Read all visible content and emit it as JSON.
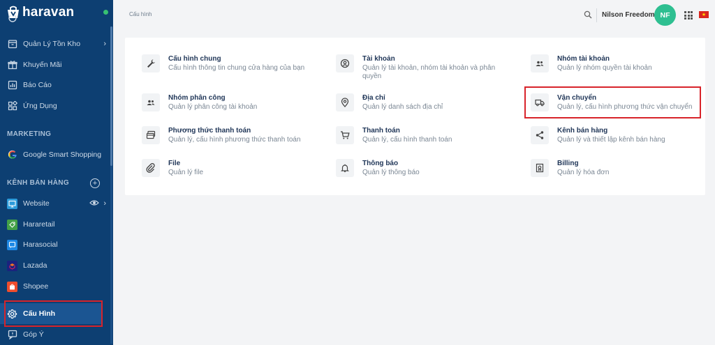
{
  "brand": {
    "name": "haravan"
  },
  "sidebar": {
    "items": [
      {
        "label": "Quản Lý Tồn Kho",
        "icon": "inventory-icon"
      },
      {
        "label": "Khuyến Mãi",
        "icon": "promotion-icon"
      },
      {
        "label": "Báo Cáo",
        "icon": "report-icon"
      },
      {
        "label": "Ứng Dụng",
        "icon": "apps-icon"
      }
    ],
    "marketing_title": "MARKETING",
    "marketing_items": [
      {
        "label": "Google Smart Shopping",
        "icon": "google-icon"
      }
    ],
    "channels_title": "KÊNH BÁN HÀNG",
    "channels": [
      {
        "label": "Website",
        "icon": "website-icon",
        "color": "#2d9cdb"
      },
      {
        "label": "Hararetail",
        "icon": "hararetail-icon",
        "color": "#43a047"
      },
      {
        "label": "Harasocial",
        "icon": "harasocial-icon",
        "color": "#1e88e5"
      },
      {
        "label": "Lazada",
        "icon": "lazada-icon",
        "color": "#1a237e"
      },
      {
        "label": "Shopee",
        "icon": "shopee-icon",
        "color": "#ee4d2d"
      }
    ],
    "active_item": {
      "label": "Cấu Hình",
      "icon": "gear-icon"
    },
    "bottom_item": {
      "label": "Góp Ý",
      "icon": "feedback-icon"
    }
  },
  "header": {
    "breadcrumb": "Cấu hình",
    "user_name": "Nilson Freedome",
    "avatar_initials": "NF"
  },
  "settings": [
    {
      "title": "Cấu hình chung",
      "desc": "Cấu hình thông tin chung cửa hàng của bạn",
      "icon": "wrench-icon"
    },
    {
      "title": "Tài khoản",
      "desc": "Quản lý tài khoản, nhóm tài khoản và phân quyền",
      "icon": "account-icon"
    },
    {
      "title": "Nhóm tài khoản",
      "desc": "Quản lý nhóm quyền tài khoản",
      "icon": "user-group-icon"
    },
    {
      "title": "Nhóm phân công",
      "desc": "Quản lý phân công tài khoản",
      "icon": "assign-group-icon"
    },
    {
      "title": "Địa chỉ",
      "desc": "Quản lý danh sách địa chỉ",
      "icon": "location-pin-icon"
    },
    {
      "title": "Vận chuyển",
      "desc": "Quản lý, cấu hình phương thức vận chuyển",
      "icon": "truck-icon"
    },
    {
      "title": "Phương thức thanh toán",
      "desc": "Quản lý, cấu hình phương thức thanh toán",
      "icon": "payment-method-icon"
    },
    {
      "title": "Thanh toán",
      "desc": "Quản lý, cấu hình thanh toán",
      "icon": "cart-icon"
    },
    {
      "title": "Kênh bán hàng",
      "desc": "Quản lý và thiết lập kênh bán hàng",
      "icon": "share-icon"
    },
    {
      "title": "File",
      "desc": "Quản lý file",
      "icon": "paperclip-icon"
    },
    {
      "title": "Thông báo",
      "desc": "Quản lý thông báo",
      "icon": "bell-icon"
    },
    {
      "title": "Billing",
      "desc": "Quản lý hóa đơn",
      "icon": "billing-icon"
    }
  ],
  "colors": {
    "sidebar_bg": "#0d3f72",
    "highlight": "#d8232a",
    "avatar_bg": "#2ebf91"
  }
}
